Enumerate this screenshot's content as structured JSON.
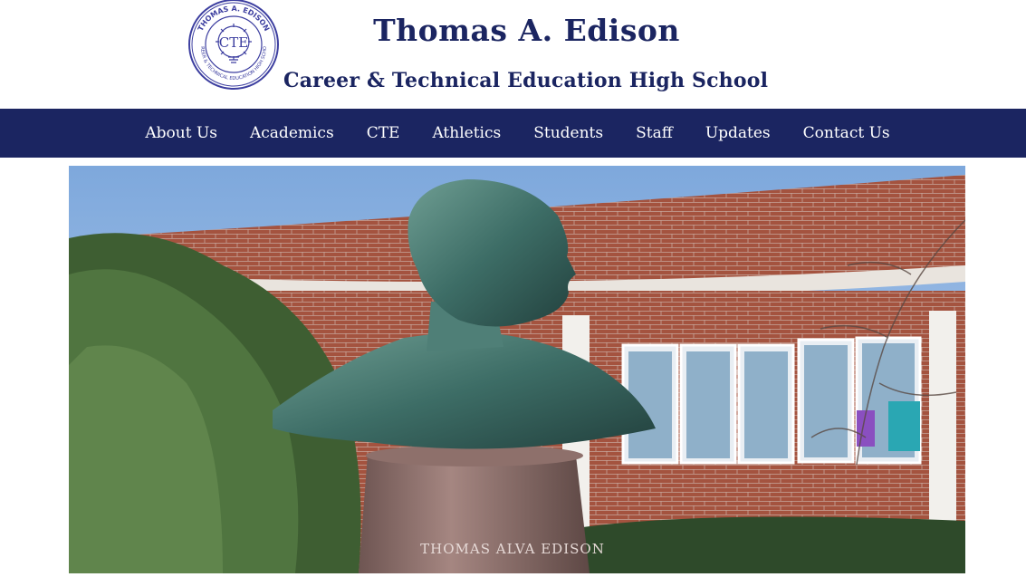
{
  "header": {
    "logo_text_top": "THOMAS A. EDISON",
    "logo_text_bottom": "CAREER & TECHNICAL EDUCATION HIGH SCHOOL",
    "logo_monogram": "CTE",
    "title": "Thomas A. Edison",
    "subtitle": "Career & Technical Education High School"
  },
  "nav": {
    "items": [
      {
        "label": "About Us"
      },
      {
        "label": "Academics"
      },
      {
        "label": "CTE"
      },
      {
        "label": "Athletics"
      },
      {
        "label": "Students"
      },
      {
        "label": "Staff"
      },
      {
        "label": "Updates"
      },
      {
        "label": "Contact Us"
      }
    ]
  },
  "hero": {
    "pedestal_inscription": "THOMAS ALVA EDISON"
  },
  "colors": {
    "brand_navy": "#1b2561",
    "nav_text": "#ffffff",
    "sky": "#8fb6e0",
    "brick": "#a0523f"
  }
}
